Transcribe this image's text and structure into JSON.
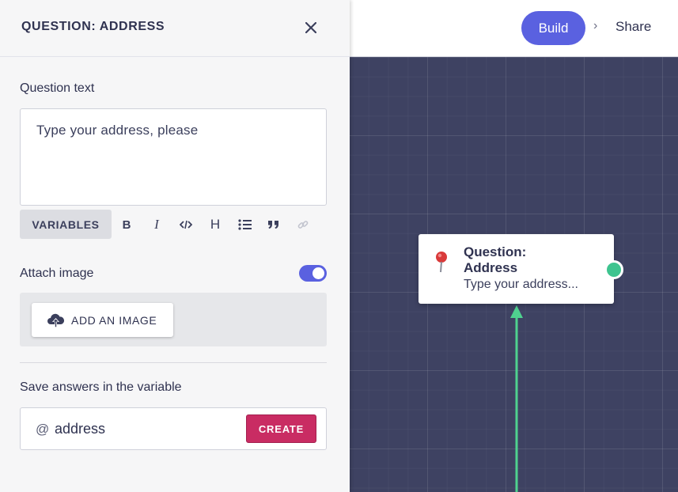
{
  "topbar": {
    "build_label": "Build",
    "separator": "›",
    "share_label": "Share"
  },
  "panel": {
    "title": "QUESTION: ADDRESS",
    "close_icon": "close-icon",
    "question_text_label": "Question text",
    "question_text_value": "Type your address, please",
    "toolbar": {
      "variables_label": "VARIABLES",
      "bold_glyph": "B",
      "italic_glyph": "I",
      "heading_glyph": "H",
      "icons": [
        "bold-icon",
        "italic-icon",
        "code-icon",
        "heading-icon",
        "list-icon",
        "quote-icon",
        "link-icon"
      ]
    },
    "attach_image_label": "Attach image",
    "attach_image_enabled": true,
    "add_image_label": "ADD AN IMAGE",
    "save_answers_label": "Save answers in the variable",
    "variable_prefix": "@",
    "variable_name": "address",
    "create_label": "CREATE"
  },
  "node": {
    "title": "Question: Address",
    "subtitle": "Type your address...",
    "icon": "pin-icon"
  },
  "colors": {
    "accent": "#5a61e0",
    "create": "#c92c63",
    "port": "#3ec48f",
    "canvas": "#3e4262"
  }
}
